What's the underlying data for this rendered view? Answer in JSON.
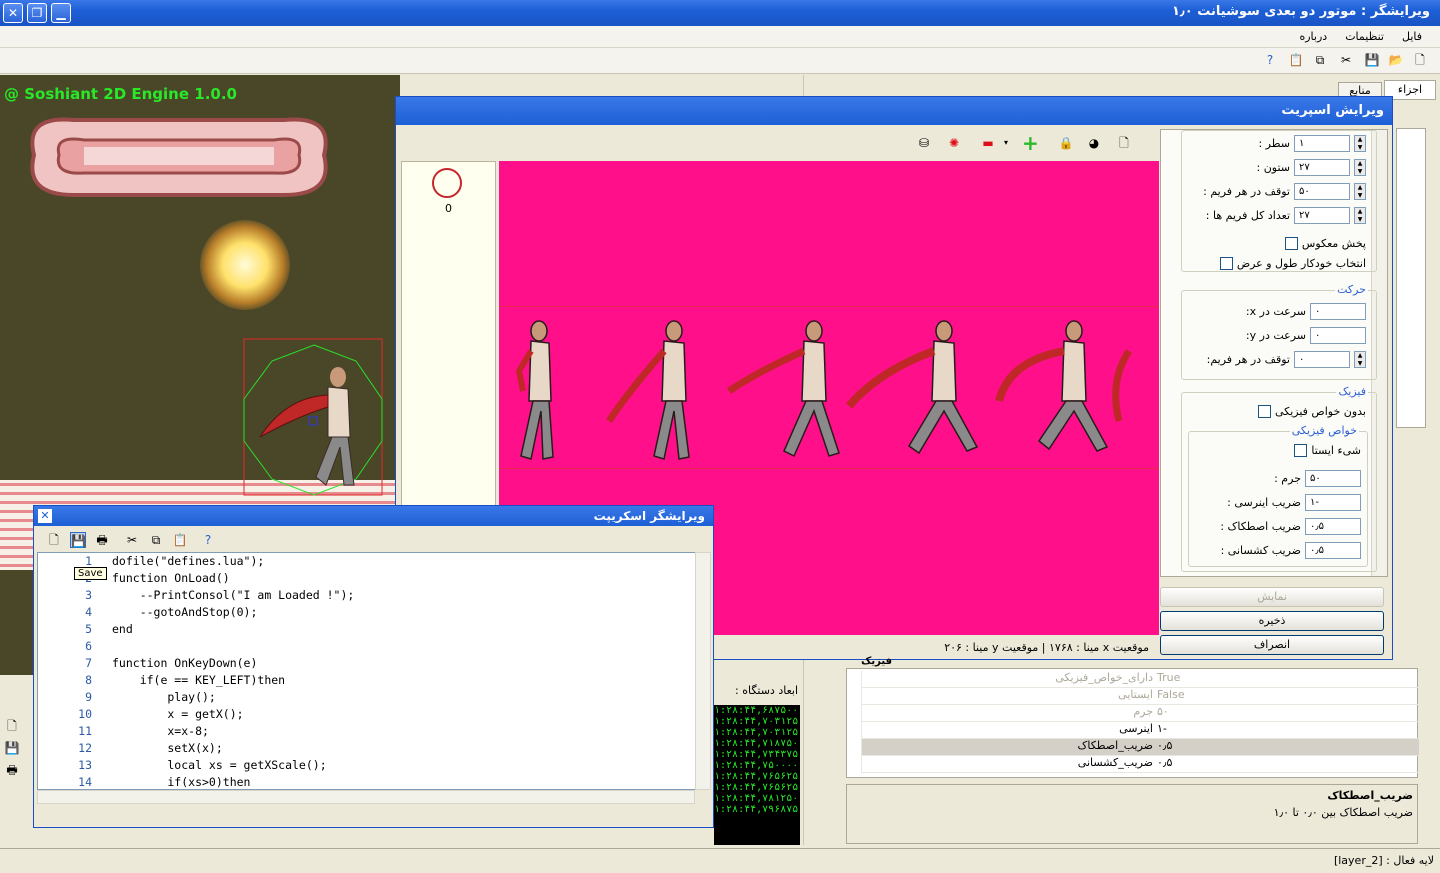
{
  "window": {
    "title": "ویرایشگر : موتور دو بعدی سوشیانت ۱٫۰"
  },
  "menu": [
    "فایل",
    "تنظیمات",
    "درباره"
  ],
  "viewport": {
    "engine_label": "@ Soshiant 2D Engine 1.0.0"
  },
  "right_tabs": [
    "اجزاء",
    "منابع"
  ],
  "sprite_editor": {
    "title": "ویرایش اسپریت",
    "frame_number": "0",
    "status": "موقعیت x مینا : ۱۷۶۸ | موقعیت y مینا : ۲۰۶",
    "fields": {
      "row_label": "سطر :",
      "row_value": "۱",
      "col_label": "ستون :",
      "col_value": "۲۷",
      "delay_label": "توقف در هر فریم :",
      "delay_value": "۵۰",
      "count_label": "تعداد کل فریم ها :",
      "count_value": "۲۷",
      "reverse_label": "پخش معکوس",
      "autosize_label": "انتخاب خودکار طول و عرض"
    },
    "motion": {
      "group_label": "حرکت",
      "vx_label": "سرعت در x:",
      "vx_value": "۰",
      "vy_label": "سرعت در y:",
      "vy_value": "۰",
      "delay_label": "توقف در هر فریم:",
      "delay_value": "۰"
    },
    "physics": {
      "group_label": "فیزیک",
      "none_label": "بدون خواص فیزیکی",
      "props_label": "خواص فیزیکی",
      "static_label": "شیء ایستا",
      "mass_label": "جرم :",
      "mass_value": "۵۰",
      "inertia_label": "ضریب اینرسی :",
      "inertia_value": "-۱",
      "friction_label": "ضریب اصطکاک :",
      "friction_value": "۰٫۵",
      "restitution_label": "ضریب کشسانی :",
      "restitution_value": "۰٫۵"
    },
    "buttons": {
      "show": "نمایش",
      "save": "ذخیره",
      "cancel": "انصراف"
    }
  },
  "script_editor": {
    "title": "ویرایشگر اسکریپت",
    "tooltip": "Save",
    "lines": [
      {
        "n": "1",
        "t": "dofile(\"defines.lua\");"
      },
      {
        "n": "2",
        "t": "function OnLoad()"
      },
      {
        "n": "3",
        "t": "    --PrintConsol(\"I am Loaded !\");"
      },
      {
        "n": "4",
        "t": "    --gotoAndStop(0);"
      },
      {
        "n": "5",
        "t": "end"
      },
      {
        "n": "6",
        "t": ""
      },
      {
        "n": "7",
        "t": "function OnKeyDown(e)"
      },
      {
        "n": "8",
        "t": "    if(e == KEY_LEFT)then"
      },
      {
        "n": "9",
        "t": "        play();"
      },
      {
        "n": "10",
        "t": "        x = getX();"
      },
      {
        "n": "11",
        "t": "        x=x-8;"
      },
      {
        "n": "12",
        "t": "        setX(x);"
      },
      {
        "n": "13",
        "t": "        local xs = getXScale();"
      },
      {
        "n": "14",
        "t": "        if(xs>0)then"
      }
    ]
  },
  "device_dims_label": "ابعاد دستگاه :",
  "console_lines": [
    "۱:۲۸:۴۴,۶۸۷۵۰۰۰",
    "۱:۲۸:۴۴,۷۰۳۱۲۵۰",
    "۱:۲۸:۴۴,۷۰۳۱۲۵۰",
    "۱:۲۸:۴۴,۷۱۸۷۵۰۰",
    "۱:۲۸:۴۴,۷۳۴۳۷۵۰",
    "۱:۲۸:۴۴,۷۵۰۰۰۰۰",
    "۱:۲۸:۴۴,۷۶۵۶۲۵۰",
    "۱:۲۸:۴۴,۷۶۵۶۲۵۰",
    "۱:۲۸:۴۴,۷۸۱۲۵۰۰",
    "۱:۲۸:۴۴,۷۹۶۸۷۵۰"
  ],
  "property_grid": {
    "section": "فیزیک",
    "rows": [
      {
        "name": "دارای_خواص_فیزیکی",
        "value": "True",
        "dim": true
      },
      {
        "name": "ایستایی",
        "value": "False",
        "dim": true
      },
      {
        "name": "جرم",
        "value": "۵۰",
        "dim": true
      },
      {
        "name": "اینرسی",
        "value": "-۱",
        "dim": false
      },
      {
        "name": "ضریب_اصطکاک",
        "value": "۰٫۵",
        "dim": false
      },
      {
        "name": "ضریب_کشسانی",
        "value": "۰٫۵",
        "dim": false
      }
    ]
  },
  "description": {
    "title": "ضریب_اصطکاک",
    "text": "ضریب اصطکاک بین ۰٫۰ تا ۱٫۰"
  },
  "statusbar": {
    "text": "لایه فعال : [layer_2]"
  }
}
